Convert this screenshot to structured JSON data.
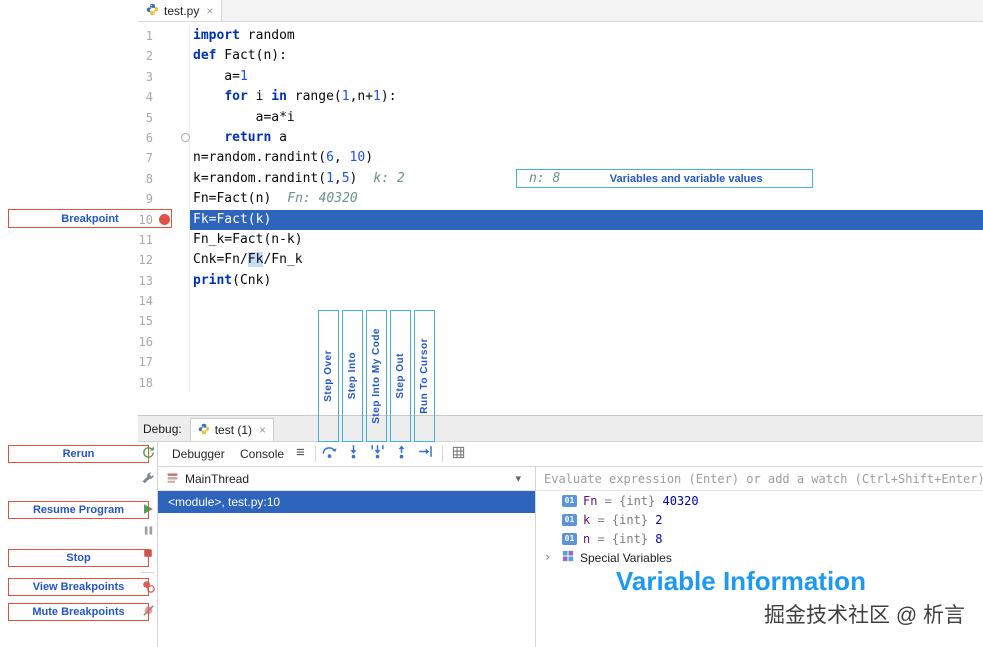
{
  "icons": {
    "close": "×",
    "menu": "≡",
    "dropdown": "▾",
    "chevron": "›"
  },
  "colors": {
    "execution_line_blue": "#2e64bc",
    "annotation_border_red": "#e64f39",
    "annotation_border_cyan": "#47aed6",
    "annotation_text_blue": "#2356c5",
    "breakpoint_red": "#e0514c",
    "info_heading_blue": "#1d9af0"
  },
  "editor_tab": {
    "title": "test.py"
  },
  "code": {
    "lines": [
      {
        "n": "1",
        "segs": [
          [
            "kw",
            "import"
          ],
          [
            "pl",
            " random"
          ]
        ]
      },
      {
        "n": "2",
        "segs": [
          [
            "kw",
            "def"
          ],
          [
            "pl",
            " Fact(n):"
          ]
        ]
      },
      {
        "n": "3",
        "segs": [
          [
            "pl",
            "    a="
          ],
          [
            "num",
            "1"
          ]
        ]
      },
      {
        "n": "4",
        "segs": [
          [
            "pl",
            "    "
          ],
          [
            "kw",
            "for"
          ],
          [
            "pl",
            " i "
          ],
          [
            "kw",
            "in"
          ],
          [
            "pl",
            " range("
          ],
          [
            "num",
            "1"
          ],
          [
            "pl",
            ",n+"
          ],
          [
            "num",
            "1"
          ],
          [
            "pl",
            "):"
          ]
        ]
      },
      {
        "n": "5",
        "segs": [
          [
            "pl",
            "        a=a*i"
          ]
        ]
      },
      {
        "n": "6",
        "segs": [
          [
            "pl",
            "    "
          ],
          [
            "kw",
            "return"
          ],
          [
            "pl",
            " a"
          ]
        ],
        "fold": true
      },
      {
        "n": "7",
        "segs": [
          [
            "pl",
            "n=random.randint("
          ],
          [
            "num",
            "6"
          ],
          [
            "pl",
            ", "
          ],
          [
            "num",
            "10"
          ],
          [
            "pl",
            ")"
          ]
        ]
      },
      {
        "n": "8",
        "segs": [
          [
            "pl",
            "k=random.randint("
          ],
          [
            "num",
            "1"
          ],
          [
            "pl",
            ","
          ],
          [
            "num",
            "5"
          ],
          [
            "pl",
            ")"
          ]
        ],
        "hint": "k: 2"
      },
      {
        "n": "9",
        "segs": [
          [
            "pl",
            "Fn=Fact(n)"
          ]
        ],
        "hint": "Fn: 40320"
      },
      {
        "n": "10",
        "segs": [
          [
            "pl",
            "Fk=Fact(k)"
          ]
        ],
        "current": true,
        "breakpoint": true
      },
      {
        "n": "11",
        "segs": [
          [
            "pl",
            "Fn_k=Fact(n-k)"
          ]
        ]
      },
      {
        "n": "12",
        "segs": [
          [
            "pl",
            "Cnk=Fn/"
          ],
          [
            "hl",
            "Fk"
          ],
          [
            "pl",
            "/Fn_k"
          ]
        ]
      },
      {
        "n": "13",
        "segs": [
          [
            "kw",
            "print"
          ],
          [
            "pl",
            "(Cnk)"
          ]
        ]
      },
      {
        "n": "14",
        "segs": []
      },
      {
        "n": "15",
        "segs": []
      },
      {
        "n": "16",
        "segs": []
      },
      {
        "n": "17",
        "segs": []
      },
      {
        "n": "18",
        "segs": []
      }
    ]
  },
  "annotations": {
    "breakpoint": "Breakpoint",
    "variables_box": {
      "hint": "n: 8",
      "label": "Variables and variable values"
    },
    "steps": [
      "Step Over",
      "Step Into",
      "Step Into My Code",
      "Step Out",
      "Run To Cursor"
    ],
    "rerun": "Rerun",
    "resume_program": "Resume Program",
    "stop": "Stop",
    "view_breakpoints": "View Breakpoints",
    "mute_breakpoints": "Mute Breakpoints",
    "variable_information": "Variable Information",
    "watermark": "掘金技术社区 @ 析言"
  },
  "debug": {
    "label": "Debug:",
    "tab": {
      "title": "test (1)"
    },
    "tabs": [
      "Debugger",
      "Console"
    ],
    "frames": {
      "thread": "MainThread",
      "frame": "<module>, test.py:10"
    },
    "watch_hint": "Evaluate expression (Enter) or add a watch (Ctrl+Shift+Enter)",
    "variables": [
      {
        "icon": "01",
        "name": "Fn",
        "type": "{int}",
        "value": "40320"
      },
      {
        "icon": "01",
        "name": "k",
        "type": "{int}",
        "value": "2"
      },
      {
        "icon": "01",
        "name": "n",
        "type": "{int}",
        "value": "8"
      },
      {
        "special": "Special Variables"
      }
    ]
  }
}
